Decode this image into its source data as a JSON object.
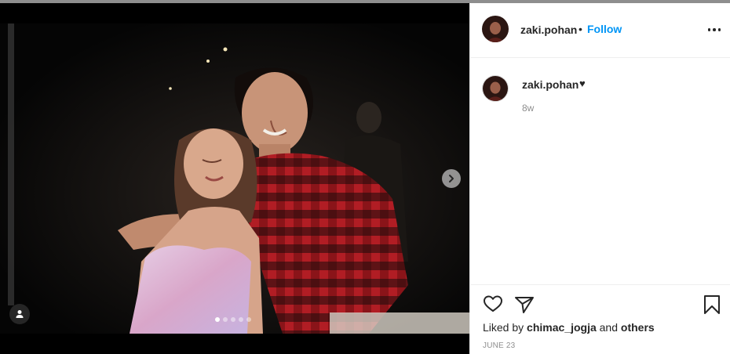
{
  "post": {
    "username": "zaki.pohan",
    "follow_label": "Follow",
    "bullet": "•",
    "caption_emoji": "♥",
    "time_ago": "8w",
    "liked_by_prefix": "Liked by",
    "liked_by_user": "chimac_jogja",
    "liked_by_conjunction": "and",
    "liked_by_others": "others",
    "date": "JUNE 23"
  },
  "carousel": {
    "slide_count": 5,
    "active_index": 0
  },
  "icons": {
    "next": "chevron-right-icon",
    "tag": "user-tag-icon",
    "more": "more-options-icon",
    "like": "heart-outline-icon",
    "share": "paper-plane-icon",
    "save": "bookmark-icon"
  },
  "colors": {
    "link_blue": "#0095f6",
    "text": "#262626",
    "muted": "#8e8e8e",
    "divider": "#efefef"
  }
}
